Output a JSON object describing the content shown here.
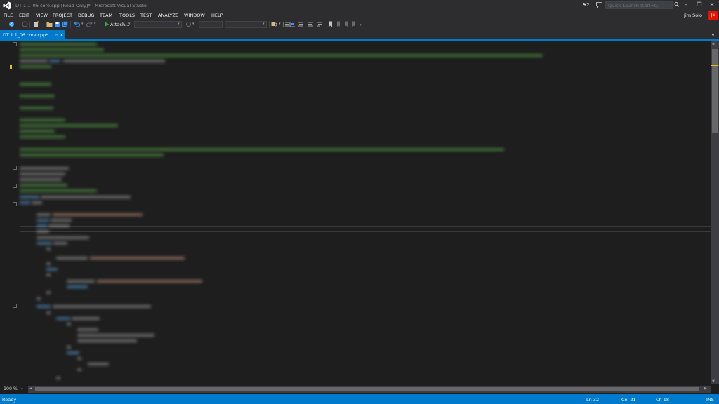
{
  "window": {
    "title": "DT 1.1_06 core.cpp [Read Only]* - Microsoft Visual Studio",
    "notification_count": "2",
    "quick_launch_placeholder": "Quick Launch (Ctrl+Q)",
    "user_name": "Jim Solo",
    "user_initials": "JS"
  },
  "menu": {
    "items": [
      "FILE",
      "EDIT",
      "VIEW",
      "PROJECT",
      "DEBUG",
      "TEAM",
      "TOOLS",
      "TEST",
      "ANALYZE",
      "WINDOW",
      "HELP"
    ]
  },
  "toolbar": {
    "attach_label": "Attach...",
    "icons": [
      "back-icon",
      "forward-icon",
      "new-project-icon",
      "open-icon",
      "save-icon",
      "save-all-icon",
      "undo-icon",
      "redo-icon",
      "start-debug-icon",
      "find-icon",
      "bookmark-icon"
    ]
  },
  "tab": {
    "label": "DT 1.1_06 core.cpp*",
    "pin_glyph": "⊣",
    "close_glyph": "×",
    "list_glyph": "▾"
  },
  "editor": {
    "zoom": "100 %"
  },
  "status": {
    "left": "Ready",
    "line": "Ln 32",
    "col": "Col 21",
    "ch": "Ch 18",
    "mode": "INS"
  },
  "colors": {
    "accent": "#007acc",
    "chrome": "#2d2d30",
    "editor_bg": "#1e1e1e",
    "avatar": "#e51400",
    "comment": "#57a64a",
    "keyword": "#569cd6"
  }
}
